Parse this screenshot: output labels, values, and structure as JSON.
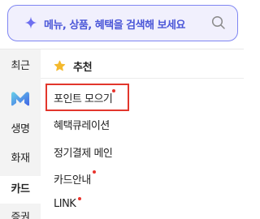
{
  "search": {
    "placeholder": "메뉴, 상품, 혜택을 검색해 보세요",
    "sparkle_icon": "sparkle-icon",
    "search_icon": "search-icon"
  },
  "colors": {
    "accent": "#4b57d8",
    "search_border": "#7f86f2",
    "search_bg": "#f1f0fd",
    "star": "#f4b92d",
    "new_dot": "#e8342d",
    "highlight": "#e2362c",
    "rail_bg": "#f3f3f3"
  },
  "rail": {
    "items": [
      {
        "label": "최근"
      },
      {
        "label": "",
        "icon": "app-logo-icon"
      },
      {
        "label": "생명"
      },
      {
        "label": "화재"
      },
      {
        "label": "카드",
        "active": true
      },
      {
        "label": "증권"
      }
    ]
  },
  "submenu": {
    "header": {
      "icon": "star-icon",
      "title": "추천"
    },
    "items": [
      {
        "label": "포인트 모으기",
        "new": true,
        "highlighted": true
      },
      {
        "label": "혜택큐레이션",
        "new": false
      },
      {
        "label": "정기결제 메인",
        "new": false
      },
      {
        "label": "카드안내",
        "new": true
      },
      {
        "label": "LINK",
        "new": true
      }
    ]
  }
}
